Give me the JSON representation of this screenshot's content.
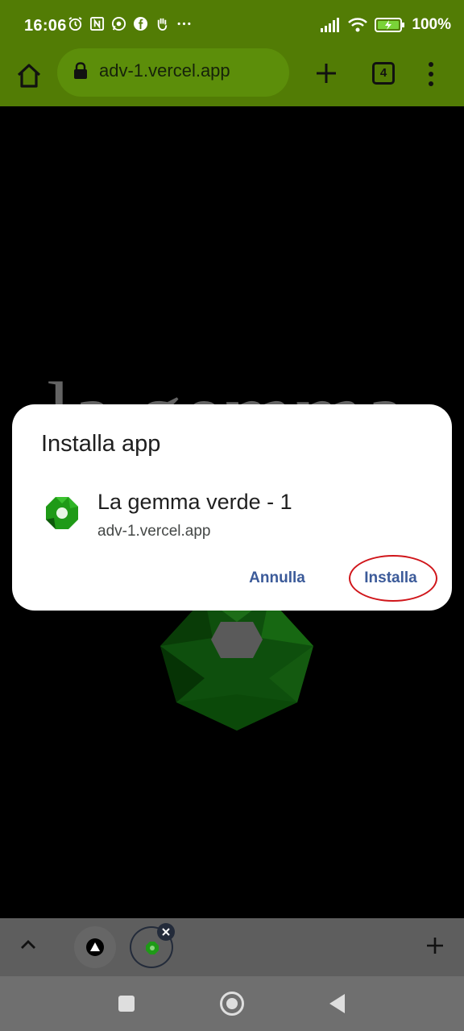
{
  "status_bar": {
    "time": "16:06",
    "left_icons": [
      "alarm-icon",
      "nfc-icon",
      "whatsapp-icon",
      "facebook-icon",
      "hand-icon",
      "more-dots-icon"
    ],
    "right_icons": [
      "signal-icon",
      "wifi-icon",
      "battery-charging-icon"
    ],
    "battery": "100%"
  },
  "toolbar": {
    "url": "adv-1.vercel.app",
    "tab_count": "4"
  },
  "page": {
    "title_text": "la gemma"
  },
  "dialog": {
    "title": "Installa app",
    "app_name": "La gemma verde - 1",
    "app_url": "adv-1.vercel.app",
    "cancel_label": "Annulla",
    "install_label": "Installa"
  },
  "colors": {
    "accent": "#527c05",
    "button_text": "#3b5a99",
    "highlight": "#d0161b",
    "gem_green": "#1f8a1a"
  }
}
